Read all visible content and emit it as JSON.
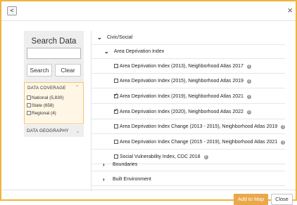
{
  "header": {
    "back_glyph": "<",
    "close_glyph": "×"
  },
  "search": {
    "title": "Search Data",
    "input_value": "",
    "search_label": "Search",
    "clear_label": "Clear"
  },
  "coverage": {
    "heading": "DATA COVERAGE",
    "options": [
      {
        "label": "National (5,830)",
        "checked": false
      },
      {
        "label": "State (658)",
        "checked": false
      },
      {
        "label": "Regional (4)",
        "checked": false
      }
    ]
  },
  "geography": {
    "heading": "DATA GEOGRAPHY"
  },
  "tree": {
    "category": "Civic/Social",
    "subcategory": "Area Deprivation Index",
    "items": [
      {
        "label": "Area Deprivation Index (2013), Neighborhood Atlas 2017",
        "checked": false
      },
      {
        "label": "Area Deprivation Index (2015), Neighborhood Atlas 2019",
        "checked": false
      },
      {
        "label": "Area Deprivation Index (2019), Neighborhood Atlas 2021",
        "checked": true
      },
      {
        "label": "Area Deprivation Index (2020), Neighborhood Atlas 2022",
        "checked": true
      },
      {
        "label": "Area Deprivation Index Change (2013 - 2015), Neighborhood Atlas 2019",
        "checked": false
      },
      {
        "label": "Area Deprivation Index Change (2015 - 2019), Neighborhood Atlas 2021",
        "checked": false
      },
      {
        "label": "Social Vulnerability Index, CDC 2018",
        "checked": false
      }
    ],
    "collapsed": [
      "Boundaries",
      "Built Environment"
    ]
  },
  "footer": {
    "add_label": "Add to Map",
    "close_label": "Close"
  },
  "icons": {
    "info": "info-icon",
    "expand": "chevron-down-icon",
    "collapsed": "chevron-right-icon"
  },
  "colors": {
    "accent": "#f0b43a",
    "add_button": "#e9a84a",
    "coverage_bg": "#fff6e6"
  }
}
